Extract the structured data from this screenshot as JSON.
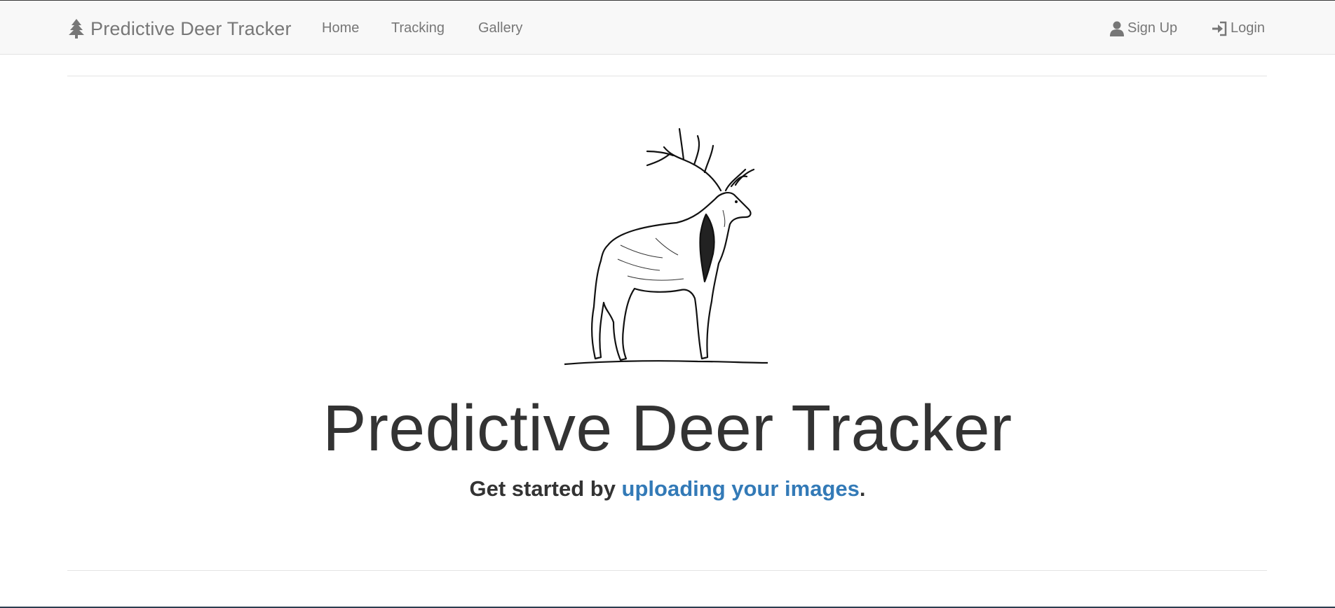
{
  "navbar": {
    "brand": "Predictive Deer Tracker",
    "brand_icon": "tree-icon",
    "links": [
      {
        "label": "Home"
      },
      {
        "label": "Tracking"
      },
      {
        "label": "Gallery"
      }
    ],
    "right_links": [
      {
        "label": "Sign Up",
        "icon": "user-icon"
      },
      {
        "label": "Login",
        "icon": "login-icon"
      }
    ]
  },
  "hero": {
    "image": "elk-illustration",
    "title": "Predictive Deer Tracker",
    "tagline_prefix": "Get started by ",
    "tagline_link": "uploading your images",
    "tagline_suffix": "."
  },
  "colors": {
    "navbar_bg": "#f8f8f8",
    "nav_text": "#777777",
    "link": "#337ab7",
    "text": "#333333"
  }
}
